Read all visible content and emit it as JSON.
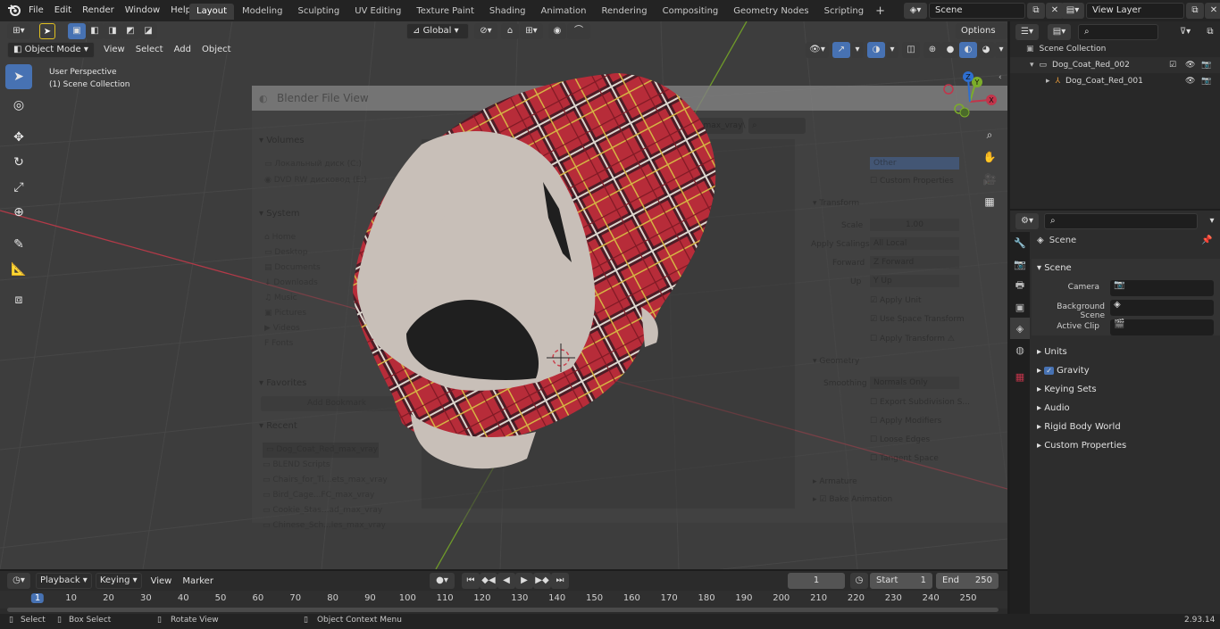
{
  "menubar": {
    "items": [
      "File",
      "Edit",
      "Render",
      "Window",
      "Help"
    ],
    "workspaces": [
      "Layout",
      "Modeling",
      "Sculpting",
      "UV Editing",
      "Texture Paint",
      "Shading",
      "Animation",
      "Rendering",
      "Compositing",
      "Geometry Nodes",
      "Scripting"
    ],
    "active_workspace": "Layout",
    "add_tab": "+",
    "scene_name": "Scene",
    "view_layer": "View Layer"
  },
  "viewport": {
    "mode": "Object Mode",
    "menus": [
      "View",
      "Select",
      "Add",
      "Object"
    ],
    "transform_orientation": "Global",
    "options": "Options",
    "info_line1": "User Perspective",
    "info_line2": "(1) Scene Collection",
    "gizmo_x": "X",
    "gizmo_y": "Y",
    "gizmo_z": "Z"
  },
  "file_dialog": {
    "title": "Blender File View",
    "path": "C:\\Users\\mvvr\\Desktop\\Dog_Coat_Red_max_vray\\",
    "volumes_label": "Volumes",
    "volumes": [
      "Локальный диск (C:)",
      "DVD RW дисковод (E:)"
    ],
    "system_label": "System",
    "system": [
      "Home",
      "Desktop",
      "Documents",
      "Downloads",
      "Music",
      "Pictures",
      "Videos",
      "Fonts"
    ],
    "favorites_label": "Favorites",
    "add_bookmark": "Add Bookmark",
    "recent_label": "Recent",
    "recent": [
      "Dog_Coat_Red_max_vray",
      "BLEND Scripts",
      "Chairs_for_Ti...ets_max_vray",
      "Bird_Cage...FC_max_vray",
      "Cookie_Stas...ad_max_vray",
      "Chinese_Sch...les_max_vray"
    ],
    "right": {
      "other": "Other",
      "custom_properties": "Custom Properties",
      "transform_label": "Transform",
      "scale_label": "Scale",
      "scale_value": "1.00",
      "apply_scalings_label": "Apply Scalings",
      "apply_scalings_value": "All Local",
      "forward_label": "Forward",
      "forward_value": "Z Forward",
      "up_label": "Up",
      "up_value": "Y Up",
      "apply_unit": "Apply Unit",
      "use_space_transform": "Use Space Transform",
      "apply_transform": "Apply Transform",
      "geometry_label": "Geometry",
      "smoothing_label": "Smoothing",
      "smoothing_value": "Normals Only",
      "export_subdivision": "Export Subdivision S...",
      "apply_modifiers": "Apply Modifiers",
      "loose_edges": "Loose Edges",
      "tangent_space": "Tangent Space",
      "armature_label": "Armature",
      "bake_animation": "Bake Animation"
    }
  },
  "outliner": {
    "root": "Scene Collection",
    "items": [
      {
        "name": "Dog_Coat_Red_002",
        "indent": 1
      },
      {
        "name": "Dog_Coat_Red_001",
        "indent": 2
      }
    ]
  },
  "properties": {
    "context": "Scene",
    "panel": "Scene",
    "camera_label": "Camera",
    "background_scene_label": "Background Scene",
    "active_clip_label": "Active Clip",
    "collapsed": [
      "Units",
      "Gravity",
      "Keying Sets",
      "Audio",
      "Rigid Body World",
      "Custom Properties"
    ]
  },
  "timeline": {
    "menus": [
      "Playback",
      "Keying",
      "View",
      "Marker"
    ],
    "current_frame": "1",
    "start_label": "Start",
    "start": "1",
    "end_label": "End",
    "end": "250",
    "ticks": [
      "1",
      "10",
      "20",
      "30",
      "40",
      "50",
      "60",
      "70",
      "80",
      "90",
      "100",
      "110",
      "120",
      "130",
      "140",
      "150",
      "160",
      "170",
      "180",
      "190",
      "200",
      "210",
      "220",
      "230",
      "240",
      "250"
    ]
  },
  "statusbar": {
    "select": "Select",
    "box_select": "Box Select",
    "rotate_view": "Rotate View",
    "context_menu": "Object Context Menu",
    "version": "2.93.14"
  },
  "colors": {
    "accent": "#4772b3",
    "x_axis": "#c2344a",
    "y_axis": "#7cad2a",
    "plaid_red": "#c7303e"
  }
}
